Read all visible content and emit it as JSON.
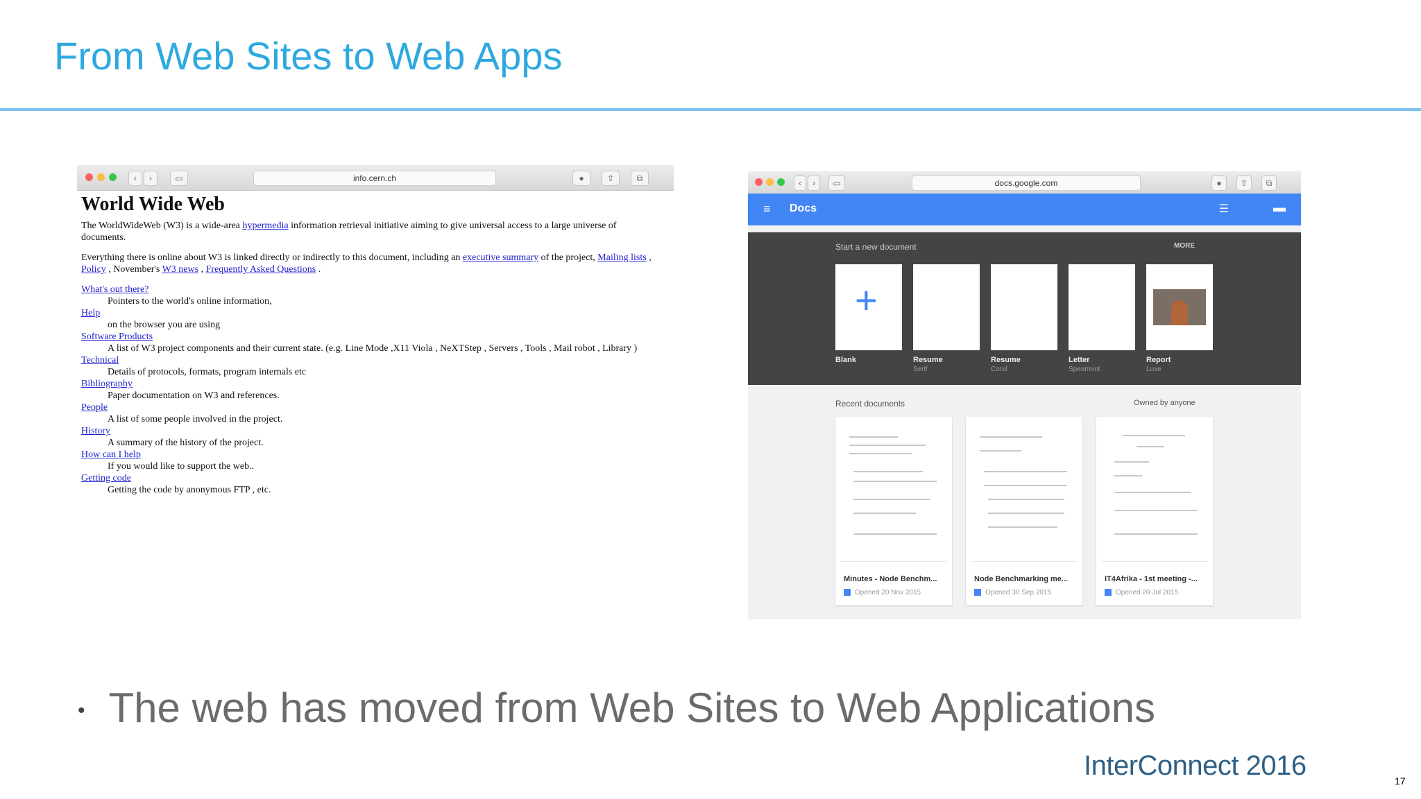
{
  "slide": {
    "title": "From Web Sites to Web Apps",
    "bullet": "The web has moved from Web Sites to Web Applications",
    "brand": "InterConnect 2016",
    "page_number": "17"
  },
  "left_browser": {
    "url": "info.cern.ch",
    "heading": "World Wide Web",
    "para1_text": "The WorldWideWeb (W3) is a wide-area",
    "para1_link": "hypermedia",
    "para1_text2": "information retrieval initiative aiming to give universal access to a large universe of documents.",
    "para2_text": "Everything there is online about W3 is linked directly or indirectly to this document, including an",
    "para2_link1": "executive summary",
    "para2_text2": "of the project,",
    "para2_link2": "Mailing lists",
    "para2_link3": "Policy",
    "para2_text3": ", November's",
    "para2_link4": "W3 news",
    "para2_link5": "Frequently Asked Questions",
    "items": [
      {
        "link": "What's out there?",
        "desc": "Pointers to the world's online information,"
      },
      {
        "link": "Help",
        "desc": "on the browser you are using"
      },
      {
        "link": "Software Products",
        "desc": "A list of W3 project components and their current state. (e.g. Line Mode ,X11 Viola , NeXTStep , Servers , Tools , Mail robot , Library )"
      },
      {
        "link": "Technical",
        "desc": "Details of protocols, formats, program internals etc"
      },
      {
        "link": "Bibliography",
        "desc": "Paper documentation on W3 and references."
      },
      {
        "link": "People",
        "desc": "A list of some people involved in the project."
      },
      {
        "link": "History",
        "desc": "A summary of the history of the project."
      },
      {
        "link": "How can I help",
        "desc": "If you would like to support the web.."
      },
      {
        "link": "Getting code",
        "desc": "Getting the code by anonymous FTP , etc."
      }
    ]
  },
  "right_browser": {
    "url": "docs.google.com",
    "app_title": "Docs",
    "start_label": "Start a new document",
    "more_label": "MORE",
    "templates": [
      {
        "name": "Blank",
        "sub": ""
      },
      {
        "name": "Resume",
        "sub": "Serif"
      },
      {
        "name": "Resume",
        "sub": "Coral"
      },
      {
        "name": "Letter",
        "sub": "Spearmint"
      },
      {
        "name": "Report",
        "sub": "Luxe"
      }
    ],
    "recent_label": "Recent documents",
    "owner_filter": "Owned by anyone",
    "recent": [
      {
        "name": "Minutes - Node Benchm...",
        "meta": "Opened 20 Nov 2015"
      },
      {
        "name": "Node Benchmarking me...",
        "meta": "Opened 30 Sep 2015"
      },
      {
        "name": "IT4Afrika - 1st meeting -...",
        "meta": "Opened 20 Jul 2015"
      }
    ]
  }
}
